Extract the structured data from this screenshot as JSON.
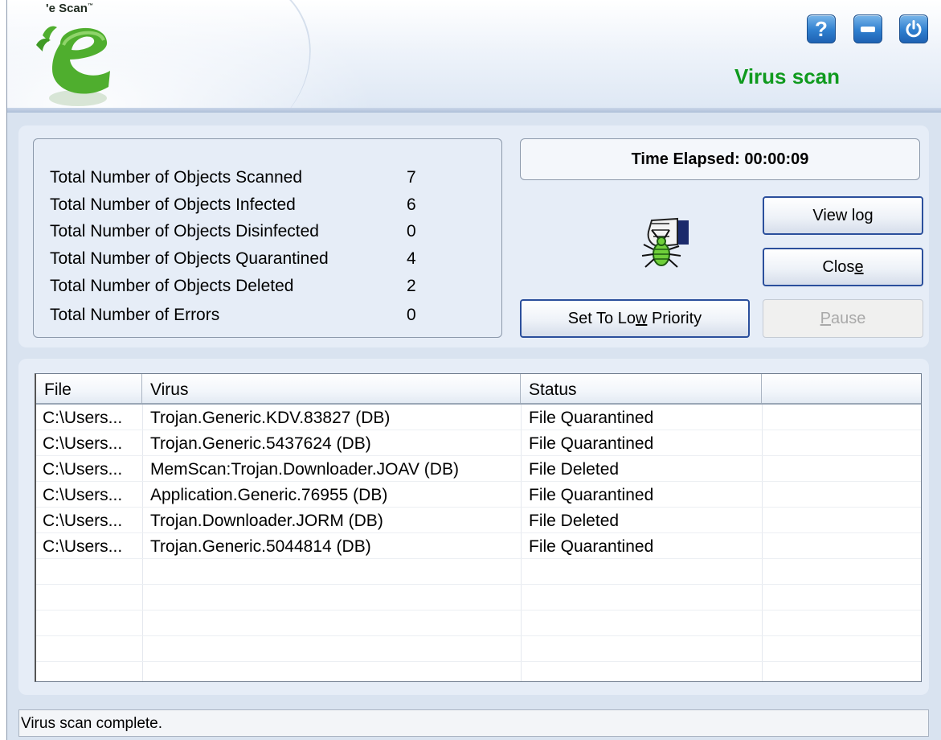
{
  "app": {
    "brand": "e Scan",
    "trademark": "™",
    "title": "Virus scan",
    "colors": {
      "title": "#0f9a1e",
      "button_blue": "#2f7fcf",
      "panel": "#e6edf7"
    }
  },
  "title_buttons": [
    {
      "name": "help",
      "icon": "help-icon",
      "glyph": "?"
    },
    {
      "name": "minimize",
      "icon": "minimize-icon",
      "glyph": "—"
    },
    {
      "name": "power",
      "icon": "power-icon",
      "glyph": "⏻"
    }
  ],
  "stats": [
    {
      "label": "Total Number of Objects Scanned",
      "value": "7"
    },
    {
      "label": "Total Number of Objects Infected",
      "value": "6"
    },
    {
      "label": "Total Number of Objects Disinfected",
      "value": "0"
    },
    {
      "label": "Total Number of Objects Quarantined",
      "value": "4"
    },
    {
      "label": "Total Number of Objects Deleted",
      "value": "2"
    },
    {
      "label": "Total Number of Errors",
      "value": "0"
    }
  ],
  "time_elapsed": "Time Elapsed: 00:00:09",
  "buttons": {
    "view_log": {
      "label": "View log",
      "pre": "View lo",
      "mn": "g",
      "post": ""
    },
    "close": {
      "label": "Close",
      "pre": "Clos",
      "mn": "e",
      "post": ""
    },
    "low_priority": {
      "label": "Set To Low Priority",
      "pre": "Set To Lo",
      "mn": "w",
      "post": " Priority"
    },
    "pause": {
      "label": "Pause",
      "pre": "",
      "mn": "P",
      "post": "ause"
    }
  },
  "table": {
    "columns": [
      "File",
      "Virus",
      "Status",
      ""
    ],
    "rows": [
      [
        "C:\\Users...",
        "Trojan.Generic.KDV.83827 (DB)",
        "File Quarantined"
      ],
      [
        "C:\\Users...",
        "Trojan.Generic.5437624 (DB)",
        "File Quarantined"
      ],
      [
        "C:\\Users...",
        "MemScan:Trojan.Downloader.JOAV (DB)",
        "File Deleted"
      ],
      [
        "C:\\Users...",
        "Application.Generic.76955 (DB)",
        "File Quarantined"
      ],
      [
        "C:\\Users...",
        "Trojan.Downloader.JORM (DB)",
        "File Deleted"
      ],
      [
        "C:\\Users...",
        "Trojan.Generic.5044814 (DB)",
        "File Quarantined"
      ]
    ]
  },
  "status_bar": "Virus scan complete."
}
